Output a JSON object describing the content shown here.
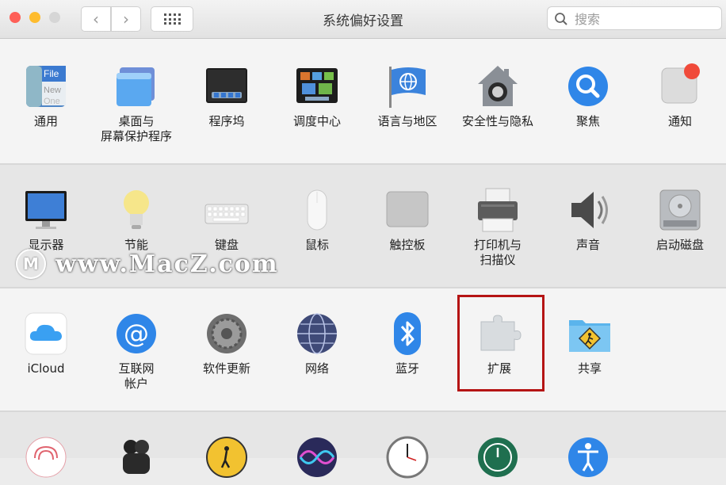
{
  "window": {
    "title": "系统偏好设置"
  },
  "toolbar": {
    "back_glyph": "‹",
    "forward_glyph": "›"
  },
  "search": {
    "placeholder": "搜索",
    "value": ""
  },
  "rows": [
    [
      {
        "label": "通用",
        "icon": "general-icon"
      },
      {
        "label": "桌面与\n屏幕保护程序",
        "icon": "desktop-screensaver-icon"
      },
      {
        "label": "程序坞",
        "icon": "dock-icon"
      },
      {
        "label": "调度中心",
        "icon": "mission-control-icon"
      },
      {
        "label": "语言与地区",
        "icon": "language-region-icon"
      },
      {
        "label": "安全性与隐私",
        "icon": "security-privacy-icon"
      },
      {
        "label": "聚焦",
        "icon": "spotlight-icon"
      },
      {
        "label": "通知",
        "icon": "notifications-icon"
      }
    ],
    [
      {
        "label": "显示器",
        "icon": "displays-icon"
      },
      {
        "label": "节能",
        "icon": "energy-saver-icon"
      },
      {
        "label": "键盘",
        "icon": "keyboard-icon"
      },
      {
        "label": "鼠标",
        "icon": "mouse-icon"
      },
      {
        "label": "触控板",
        "icon": "trackpad-icon"
      },
      {
        "label": "打印机与\n扫描仪",
        "icon": "printers-scanners-icon"
      },
      {
        "label": "声音",
        "icon": "sound-icon"
      },
      {
        "label": "启动磁盘",
        "icon": "startup-disk-icon"
      }
    ],
    [
      {
        "label": "iCloud",
        "icon": "icloud-icon"
      },
      {
        "label": "互联网\n帐户",
        "icon": "internet-accounts-icon"
      },
      {
        "label": "软件更新",
        "icon": "software-update-icon"
      },
      {
        "label": "网络",
        "icon": "network-icon"
      },
      {
        "label": "蓝牙",
        "icon": "bluetooth-icon"
      },
      {
        "label": "扩展",
        "icon": "extensions-icon"
      },
      {
        "label": "共享",
        "icon": "sharing-icon"
      }
    ],
    [
      {
        "label": "",
        "icon": "touch-id-icon"
      },
      {
        "label": "",
        "icon": "users-groups-icon"
      },
      {
        "label": "",
        "icon": "parental-controls-icon"
      },
      {
        "label": "",
        "icon": "siri-icon"
      },
      {
        "label": "",
        "icon": "date-time-icon"
      },
      {
        "label": "",
        "icon": "time-machine-icon"
      },
      {
        "label": "",
        "icon": "accessibility-icon"
      }
    ]
  ],
  "watermark": {
    "logo": "M",
    "text": "www.MacZ.com"
  },
  "colors": {
    "highlight": "#b51414",
    "accent": "#2f86e8"
  }
}
